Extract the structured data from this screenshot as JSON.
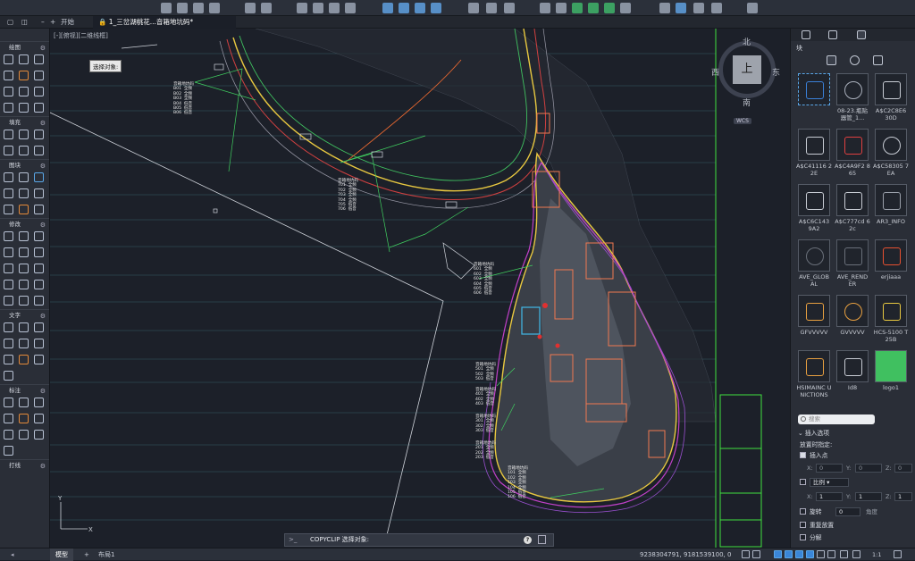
{
  "tabs": {
    "start": "开始",
    "document": "1_三岔湖桃花...音箱地坑码*"
  },
  "viewport": {
    "view_label": "[-][俯视][二维线框]",
    "prompt": "选择对象:",
    "compass": {
      "north": "北",
      "south": "南",
      "east": "东",
      "west": "西",
      "face": "上",
      "wcs": "WCS"
    }
  },
  "left_panel": {
    "sections": [
      "绘图",
      "填充",
      "图块",
      "修改",
      "文字",
      "标注",
      "打线"
    ]
  },
  "drawing_notes": {
    "n1": [
      "音箱地坑码",
      "B01  全频",
      "B02  全频",
      "B03  全频",
      "B04  低音",
      "B05  低音",
      "B06  低音"
    ],
    "n2": [
      "音箱地坑码",
      "701  全频",
      "702  全频",
      "703  全频",
      "704  全频",
      "705  低音",
      "706  低音"
    ],
    "n3": [
      "音箱地坑码",
      "601  全频",
      "602  全频",
      "603  全频",
      "604  全频",
      "605  低音",
      "606  低音"
    ],
    "n4": [
      "音箱地坑码",
      "501  全频",
      "502  全频",
      "503  低音"
    ],
    "n5": [
      "音箱地坑码",
      "401  全频",
      "402  全频",
      "403  低音"
    ],
    "n6": [
      "音箱地坑码",
      "301  全频",
      "302  全频",
      "303  低音"
    ],
    "n7": [
      "音箱地坑码",
      "201  全频",
      "202  全频",
      "203  低音"
    ],
    "n8": [
      "音箱地坑码",
      "101  全频",
      "102  全频",
      "103  全频",
      "104  全频",
      "105  低音",
      "106  低音"
    ]
  },
  "command_line": {
    "prefix": ">_",
    "text": "COPYCLIP 选择对象:"
  },
  "status_bar": {
    "model_tab": "模型",
    "layout_tab": "布局1",
    "coords": "9238304791, 9181539100, 0",
    "scale": "1:1"
  },
  "right_panel": {
    "title": "块",
    "blocks": [
      {
        "label": ""
      },
      {
        "label": "08-23.瓶贴 器管_1..."
      },
      {
        "label": "A$C2C8E6 30D"
      },
      {
        "label": "A$C41116 22E"
      },
      {
        "label": "A$C4A9F2 865"
      },
      {
        "label": "A$C58305 7EA"
      },
      {
        "label": "A$C6C143 9A2"
      },
      {
        "label": "A$C777cd 62c"
      },
      {
        "label": "AR3_INFO"
      },
      {
        "label": "AVE_GLOB AL"
      },
      {
        "label": "AVE_REND ER"
      },
      {
        "label": "erjiaaa"
      },
      {
        "label": "GFVVVVV"
      },
      {
        "label": "GVVVVV"
      },
      {
        "label": "HCS-5100 T25B"
      },
      {
        "label": "HSIMAINC UNICTIONS"
      },
      {
        "label": "Id8"
      },
      {
        "label": "logo1"
      }
    ],
    "search_placeholder": "搜索",
    "insert_options": "插入选项",
    "specify_on_place": "放置时指定:",
    "insert_point": "插入点",
    "scale_label": "比例",
    "rotation": "旋转",
    "rotation_value": "0",
    "angle": "角度",
    "repeat_place": "重复放置",
    "explode": "分解",
    "x": "X:",
    "y": "Y:",
    "z": "Z:",
    "zero": "0",
    "one": "1"
  }
}
